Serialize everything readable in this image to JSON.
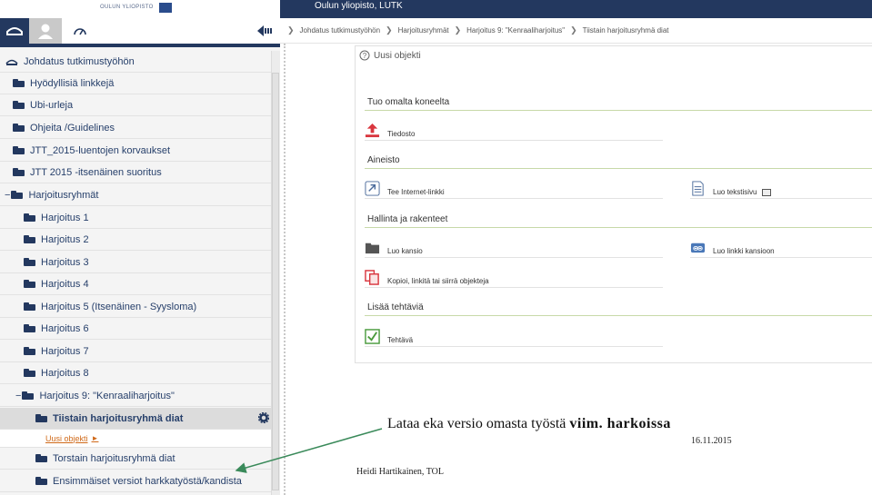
{
  "logo": {
    "text": "OULUN YLIOPISTO"
  },
  "topbar": {
    "title": "Oulun yliopisto, LUTK"
  },
  "breadcrumb": [
    "Johdatus tutkimustyöhön",
    "Harjoitusryhmät",
    "Harjoitus 9: \"Kenraaliharjoitus\"",
    "Tiistain harjoitusryhmä diat"
  ],
  "tree": {
    "root": "Johdatus tutkimustyöhön",
    "items": [
      "Hyödyllisiä linkkejä",
      "Ubi-urleja",
      "Ohjeita /Guidelines",
      "JTT_2015-luentojen korvaukset",
      "JTT 2015 -itsenäinen suoritus",
      "Harjoitusryhmät",
      "Harjoitus 1",
      "Harjoitus 2",
      "Harjoitus 3",
      "Harjoitus 4",
      "Harjoitus 5 (Itsenäinen - Syysloma)",
      "Harjoitus 6",
      "Harjoitus 7",
      "Harjoitus 8",
      "Harjoitus 9: \"Kenraaliharjoitus\"",
      "Tiistain harjoitusryhmä diat",
      "Uusi objekti",
      "Torstain harjoitusryhmä diat",
      "Ensimmäiset versiot harkkatyöstä/kandista"
    ]
  },
  "panel": {
    "title": "Uusi objekti",
    "sections": {
      "tuo": "Tuo omalta koneelta",
      "aineisto": "Aineisto",
      "hallinta": "Hallinta ja rakenteet",
      "tehtavia": "Lisää tehtäviä"
    },
    "options": {
      "tiedosto": "Tiedosto",
      "linkki": "Tee Internet-linkki",
      "tekstisivu": "Luo tekstisivu",
      "kansio": "Luo kansio",
      "kansiolinkki": "Luo linkki kansioon",
      "kopioi": "Kopioi, linkitä tai siirrä objekteja",
      "tehtava": "Tehtävä"
    }
  },
  "annotation": {
    "text": "Lataa eka versio omasta työstä ",
    "bold": "viim. harkoissa"
  },
  "date": "16.11.2015",
  "author": "Heidi Hartikainen, TOL",
  "colors": {
    "navy": "#23385f",
    "green_rule": "#c7d9a8",
    "link_orange": "#d06a1a"
  }
}
